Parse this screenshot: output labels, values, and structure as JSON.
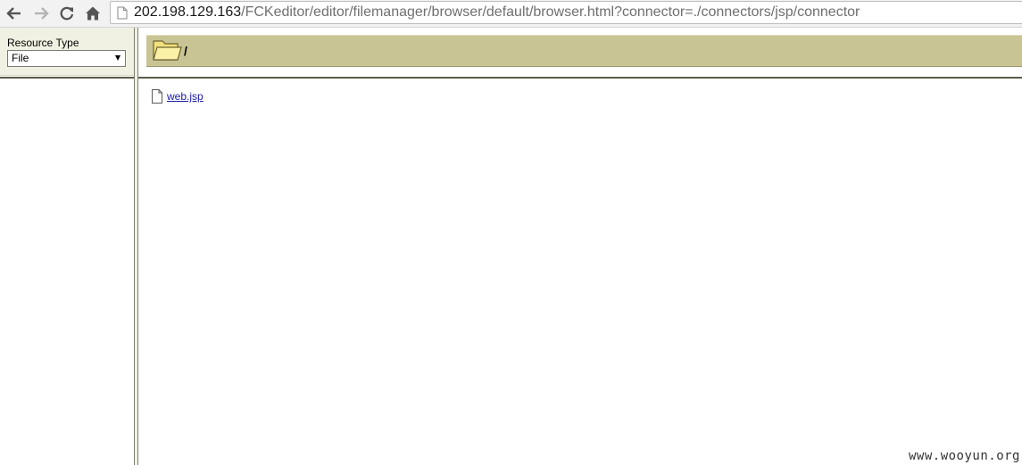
{
  "browser": {
    "url_host": "202.198.129.163",
    "url_path": "/FCKeditor/editor/filemanager/browser/default/browser.html?connector=./connectors/jsp/connector",
    "icons": {
      "back": "back-arrow-icon",
      "forward": "forward-arrow-icon",
      "reload": "reload-icon",
      "home": "home-icon",
      "page": "page-icon"
    }
  },
  "left_frame": {
    "resource_type_label": "Resource Type",
    "resource_type_selected": "File"
  },
  "right_frame": {
    "current_folder": "/",
    "files": [
      {
        "name": "web.jsp"
      }
    ]
  },
  "watermark": "www.wooyun.org",
  "colors": {
    "folder_bar": "#c9c494",
    "left_header": "#f1f1e3",
    "link": "#1a1aa6"
  }
}
